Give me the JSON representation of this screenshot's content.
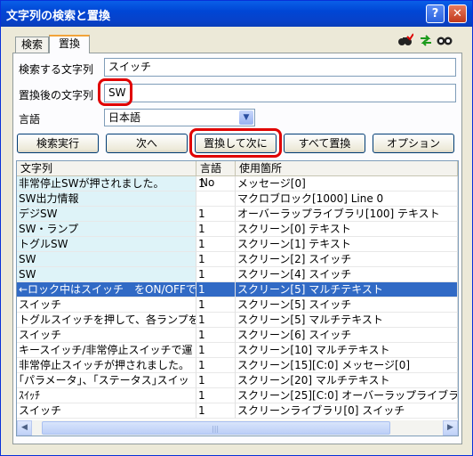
{
  "window": {
    "title": "文字列の検索と置換",
    "help_label": "?",
    "close_label": "✕"
  },
  "tabs": [
    {
      "label": "検索"
    },
    {
      "label": "置換"
    }
  ],
  "toolbar": {
    "icons": [
      "binoculars-check-icon",
      "green-arrows-icon",
      "binoculars-icon"
    ]
  },
  "form": {
    "search_label": "検索する文字列",
    "search_value": "スイッチ",
    "replace_label": "置換後の文字列",
    "replace_value": "SW",
    "language_label": "言語",
    "language_value": "日本語"
  },
  "buttons": {
    "search": "検索実行",
    "next": "次へ",
    "replace_next": "置換して次に",
    "replace_all": "すべて置換",
    "options": "オプション"
  },
  "table": {
    "columns": [
      "文字列",
      "言語No",
      "使用箇所"
    ],
    "rows": [
      {
        "text": "非常停止SWが押されました。",
        "lang": "1",
        "loc": "メッセージ[0]"
      },
      {
        "text": "SW出力情報",
        "lang": "",
        "loc": "マクロブロック[1000] Line 0"
      },
      {
        "text": "デジSW",
        "lang": "1",
        "loc": "オーバーラップライブラリ[100] テキスト"
      },
      {
        "text": "SW・ランプ",
        "lang": "1",
        "loc": "スクリーン[0] テキスト"
      },
      {
        "text": "トグルSW",
        "lang": "1",
        "loc": "スクリーン[1] テキスト"
      },
      {
        "text": "SW",
        "lang": "1",
        "loc": "スクリーン[2] スイッチ"
      },
      {
        "text": "SW",
        "lang": "1",
        "loc": "スクリーン[4] スイッチ"
      },
      {
        "text": "←ロック中はスイッチ　をON/OFFでき",
        "lang": "1",
        "loc": "スクリーン[5] マルチテキスト"
      },
      {
        "text": "スイッチ",
        "lang": "1",
        "loc": "スクリーン[5] スイッチ"
      },
      {
        "text": "トグルスイッチを押して、各ランプを",
        "lang": "1",
        "loc": "スクリーン[5] マルチテキスト"
      },
      {
        "text": "スイッチ",
        "lang": "1",
        "loc": "スクリーン[6] スイッチ"
      },
      {
        "text": "キースイッチ/非常停止スイッチで運",
        "lang": "1",
        "loc": "スクリーン[10] マルチテキスト"
      },
      {
        "text": "非常停止スイッチが押されました。",
        "lang": "1",
        "loc": "スクリーン[15][C:0] メッセージ[0]"
      },
      {
        "text": "｢パラメータ｣、｢ステータス｣スイッ",
        "lang": "1",
        "loc": "スクリーン[20] マルチテキスト"
      },
      {
        "text": "ｽｲｯﾁ",
        "lang": "1",
        "loc": "スクリーン[25][C:0] オーバーラップライブラ"
      },
      {
        "text": "スイッチ",
        "lang": "1",
        "loc": "スクリーンライブラリ[0] スイッチ"
      }
    ],
    "highlighted_count": 7,
    "selected_index": 7
  }
}
